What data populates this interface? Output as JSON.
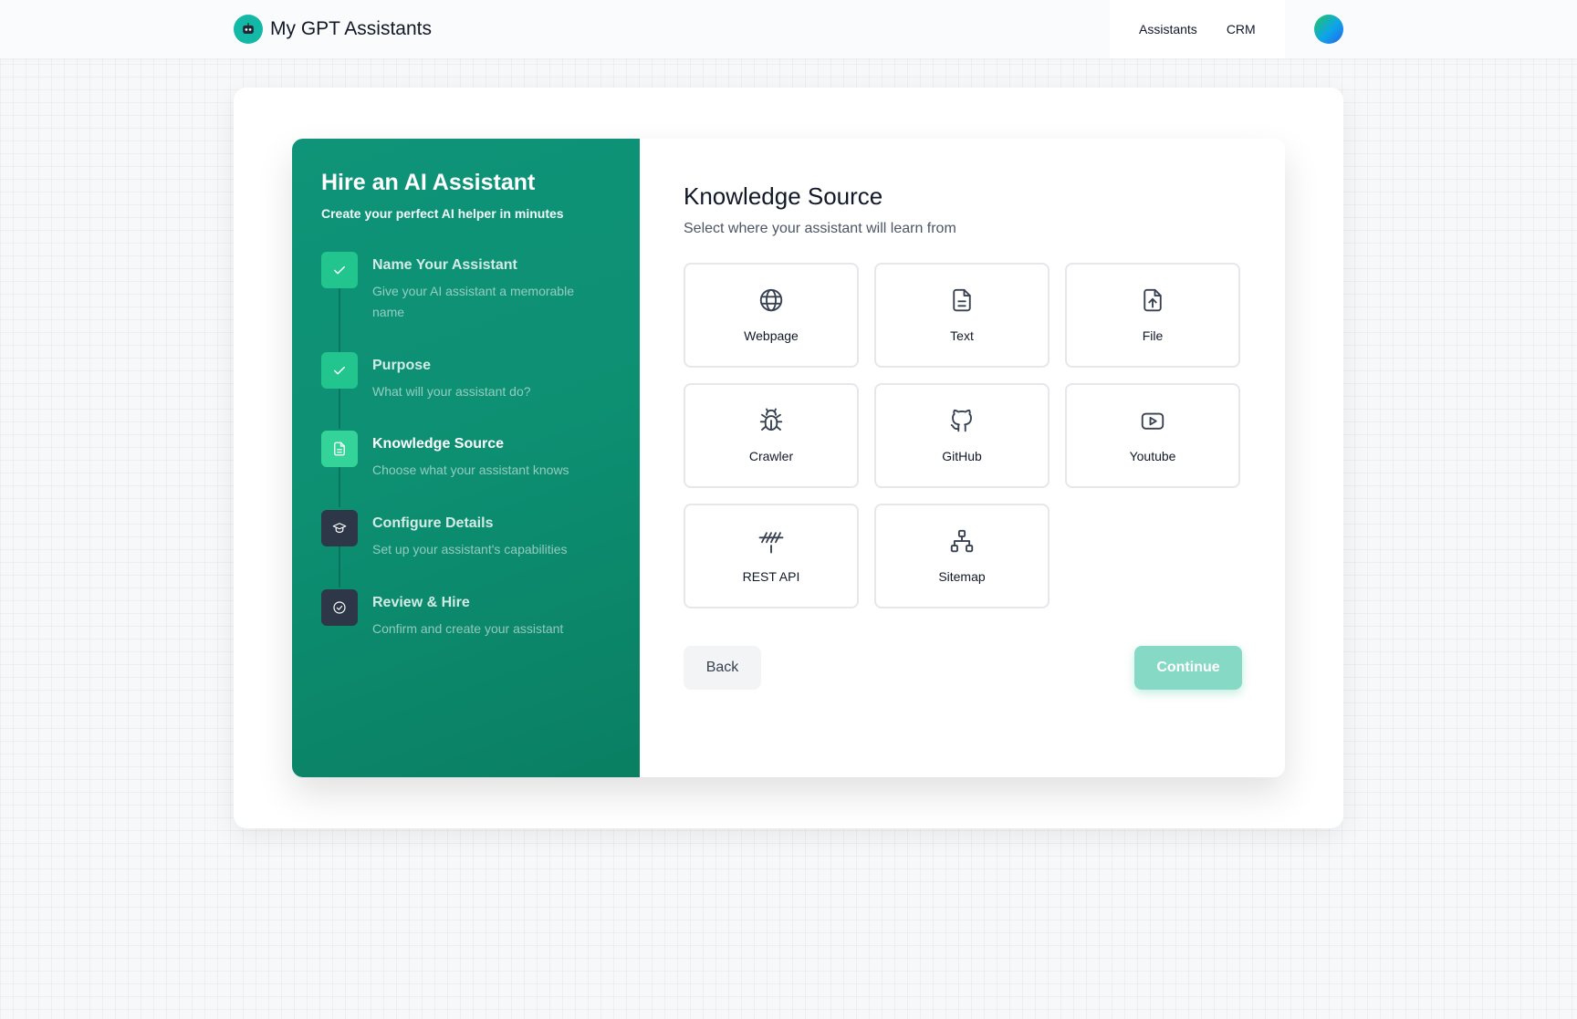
{
  "app": {
    "title": "My GPT Assistants",
    "nav": [
      {
        "label": "Assistants"
      },
      {
        "label": "CRM"
      }
    ]
  },
  "wizard": {
    "title": "Hire an AI Assistant",
    "subtitle": "Create your perfect AI helper in minutes",
    "steps": [
      {
        "title": "Name Your Assistant",
        "description": "Give your AI assistant a memorable name",
        "status": "completed",
        "icon": "check-icon"
      },
      {
        "title": "Purpose",
        "description": "What will your assistant do?",
        "status": "completed",
        "icon": "check-icon"
      },
      {
        "title": "Knowledge Source",
        "description": "Choose what your assistant knows",
        "status": "current",
        "icon": "document-icon"
      },
      {
        "title": "Configure Details",
        "description": "Set up your assistant's capabilities",
        "status": "pending",
        "icon": "graduation-cap-icon"
      },
      {
        "title": "Review & Hire",
        "description": "Confirm and create your assistant",
        "status": "pending",
        "icon": "check-circle-icon"
      }
    ]
  },
  "knowledge": {
    "title": "Knowledge Source",
    "subtitle": "Select where your assistant will learn from",
    "options": [
      {
        "label": "Webpage",
        "icon": "globe-icon"
      },
      {
        "label": "Text",
        "icon": "document-text-icon"
      },
      {
        "label": "File",
        "icon": "file-upload-icon"
      },
      {
        "label": "Crawler",
        "icon": "bug-icon"
      },
      {
        "label": "GitHub",
        "icon": "github-icon"
      },
      {
        "label": "Youtube",
        "icon": "youtube-icon"
      },
      {
        "label": "REST API",
        "icon": "api-icon"
      },
      {
        "label": "Sitemap",
        "icon": "sitemap-icon"
      }
    ],
    "back_label": "Back",
    "continue_label": "Continue"
  },
  "colors": {
    "brand_green": "#0f9479",
    "step_completed": "#22c58e",
    "step_current": "#34d399",
    "step_pending": "#2d3748",
    "continue_disabled": "#86d9c4"
  }
}
